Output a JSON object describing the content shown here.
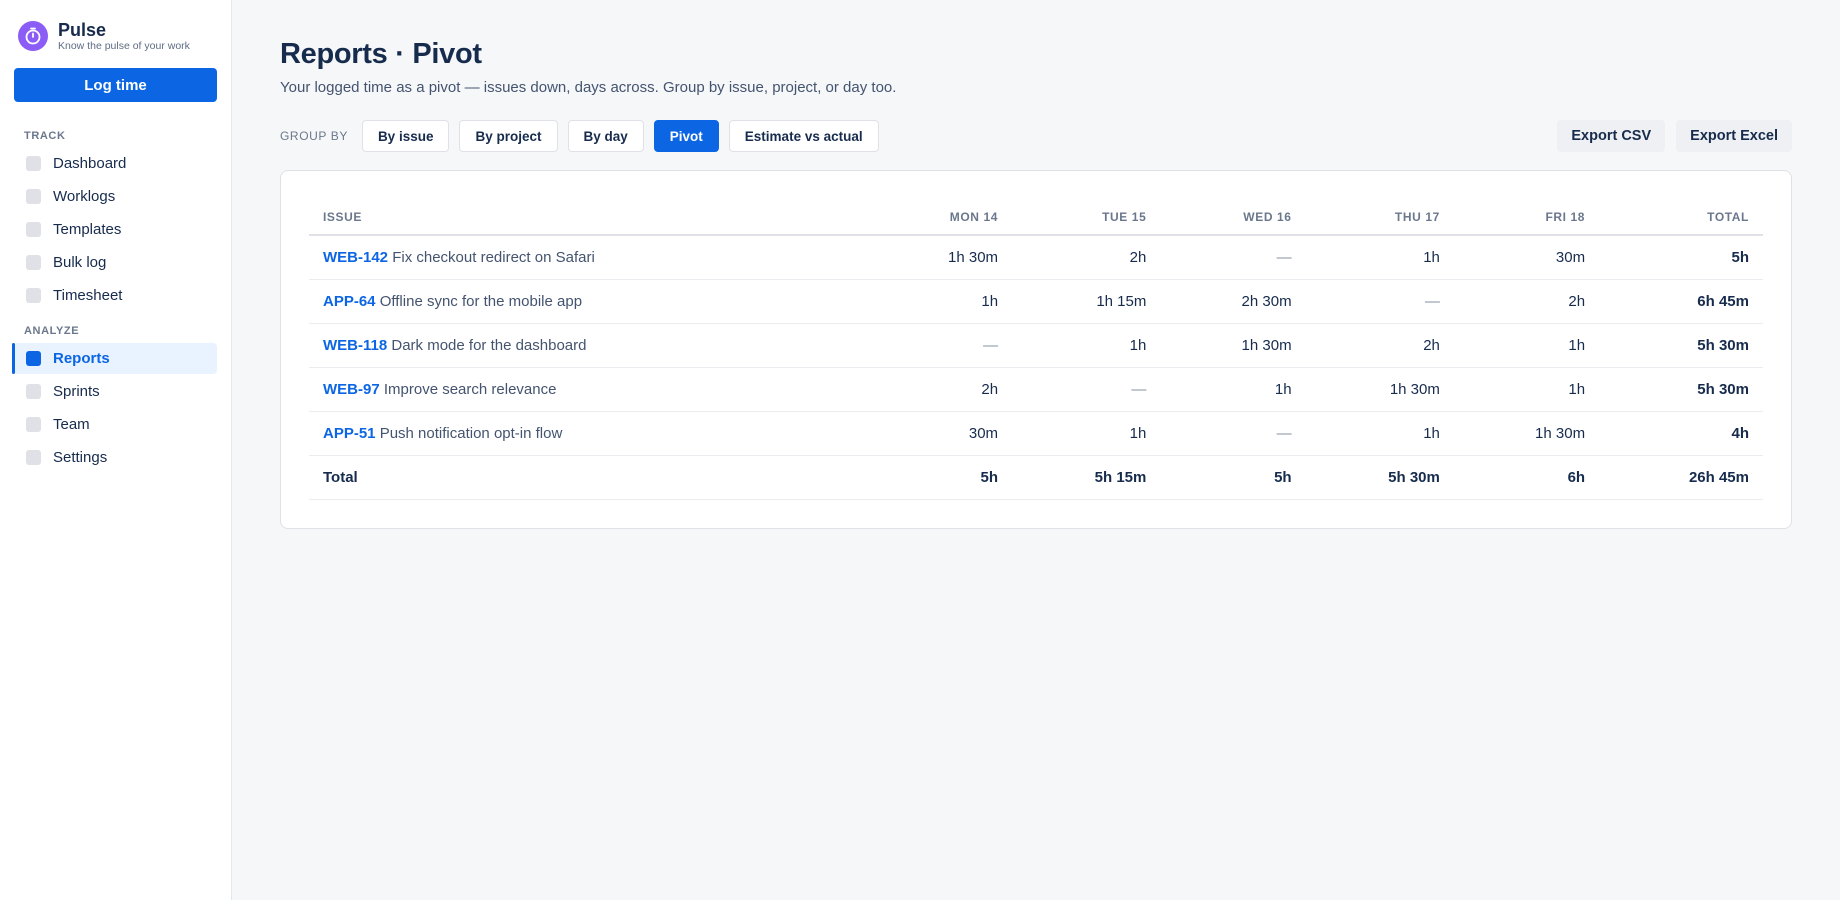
{
  "app": {
    "name": "Pulse",
    "tagline": "Know the pulse of your work",
    "log_button": "Log time",
    "accent": "#0c66e4",
    "logo_color": "#8b5cf6"
  },
  "sidebar": {
    "track_label": "TRACK",
    "track_items": [
      {
        "label": "Dashboard"
      },
      {
        "label": "Worklogs"
      },
      {
        "label": "Templates"
      },
      {
        "label": "Bulk log"
      },
      {
        "label": "Timesheet"
      }
    ],
    "analyze_label": "ANALYZE",
    "analyze_items": [
      {
        "label": "Reports",
        "active": true
      },
      {
        "label": "Sprints"
      },
      {
        "label": "Team"
      },
      {
        "label": "Settings"
      }
    ]
  },
  "main": {
    "title": "Reports · Pivot",
    "subtitle": "Your logged time as a pivot — issues down, days across. Group by issue, project, or day too.",
    "group_by_label": "GROUP BY",
    "group_buttons": [
      {
        "label": "By issue"
      },
      {
        "label": "By project"
      },
      {
        "label": "By day"
      },
      {
        "label": "Pivot",
        "active": true
      },
      {
        "label": "Estimate vs actual"
      }
    ],
    "export_csv": "Export CSV",
    "export_excel": "Export Excel"
  },
  "table": {
    "headers": [
      "ISSUE",
      "MON 14",
      "TUE 15",
      "WED 16",
      "THU 17",
      "FRI 18",
      "TOTAL"
    ],
    "rows": [
      {
        "key": "WEB-142",
        "title": "Fix checkout redirect on Safari",
        "cells": [
          "1h 30m",
          "2h",
          "—",
          "1h",
          "30m"
        ],
        "total": "5h"
      },
      {
        "key": "APP-64",
        "title": "Offline sync for the mobile app",
        "cells": [
          "1h",
          "1h 15m",
          "2h 30m",
          "—",
          "2h"
        ],
        "total": "6h 45m"
      },
      {
        "key": "WEB-118",
        "title": "Dark mode for the dashboard",
        "cells": [
          "—",
          "1h",
          "1h 30m",
          "2h",
          "1h"
        ],
        "total": "5h 30m"
      },
      {
        "key": "WEB-97",
        "title": "Improve search relevance",
        "cells": [
          "2h",
          "—",
          "1h",
          "1h 30m",
          "1h"
        ],
        "total": "5h 30m"
      },
      {
        "key": "APP-51",
        "title": "Push notification opt-in flow",
        "cells": [
          "30m",
          "1h",
          "—",
          "1h",
          "1h 30m"
        ],
        "total": "4h"
      }
    ],
    "footer": {
      "label": "Total",
      "cells": [
        "5h",
        "5h 15m",
        "5h",
        "5h 30m",
        "6h"
      ],
      "total": "26h 45m"
    }
  }
}
